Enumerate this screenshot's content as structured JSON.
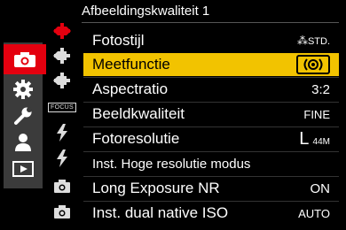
{
  "header": {
    "title": "Afbeeldingskwaliteit 1"
  },
  "main_tabs": [
    {
      "name": "camera-tab",
      "icon": "camera-icon",
      "active": true
    },
    {
      "name": "gear-tab",
      "icon": "gear-icon"
    },
    {
      "name": "wrench-tab",
      "icon": "wrench-icon"
    },
    {
      "name": "person-tab",
      "icon": "person-icon"
    },
    {
      "name": "playback-tab",
      "icon": "playback-icon"
    }
  ],
  "sub_icons": [
    "quality-icon-1-active",
    "quality-icon-2",
    "quality-icon-3",
    "focus-icon",
    "flash-icon",
    "flash-icon-2",
    "camera-small-icon",
    "camera-small-icon-2"
  ],
  "focus_tag": "FOCUS",
  "menu_items": [
    {
      "label": "Fotostijl",
      "value": "STD.",
      "value_prefix": "⁂"
    },
    {
      "label": "Meetfunctie",
      "value": "(◉)",
      "selected": true
    },
    {
      "label": "Aspectratio",
      "value": "3:2"
    },
    {
      "label": "Beeldkwaliteit",
      "value": "FINE"
    },
    {
      "label": "Fotoresolutie",
      "value": "L",
      "value_suffix": "44M"
    },
    {
      "label": "Inst. Hoge resolutie modus",
      "value": ""
    },
    {
      "label": "Long Exposure NR",
      "value": "ON"
    },
    {
      "label": "Inst. dual native ISO",
      "value": "AUTO"
    }
  ],
  "colors": {
    "accent_red": "#e4000f",
    "highlight_yellow": "#f2c300",
    "tab_gray": "#3b3b3b"
  }
}
